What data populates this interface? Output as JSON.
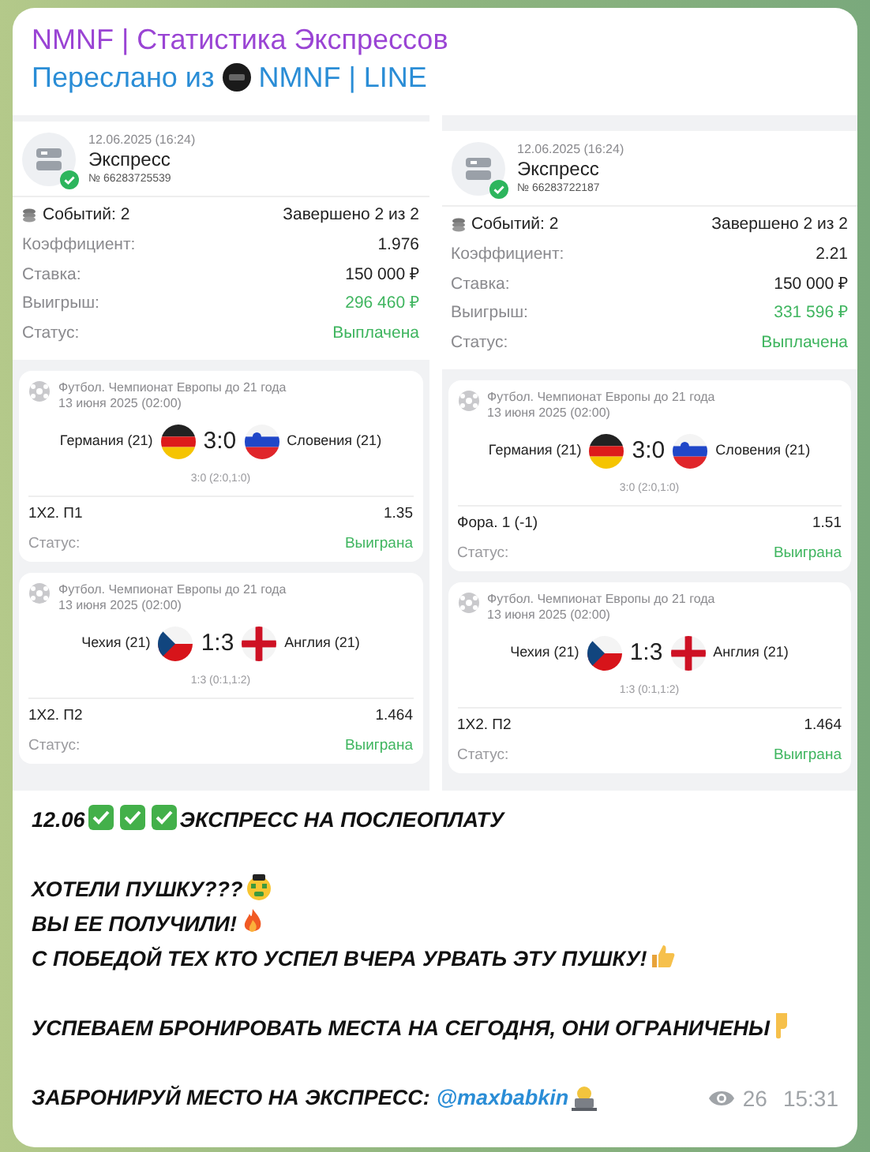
{
  "title": "NMNF | Статистика Экспрессов",
  "forwarded": {
    "label": "Переслано из",
    "channel": "NMNF | LINE"
  },
  "slips": [
    {
      "date": "12.06.2025 (16:24)",
      "title": "Экспресс",
      "number": "№ 66283725539",
      "events": "Событий: 2",
      "completed": "Завершено 2 из 2",
      "rows": [
        {
          "label": "Коэффициент:",
          "value": "1.976"
        },
        {
          "label": "Ставка:",
          "value": "150 000 ₽"
        },
        {
          "label": "Выигрыш:",
          "value": "296 460 ₽"
        },
        {
          "label": "Статус:",
          "value": "Выплачена"
        }
      ],
      "matches": [
        {
          "league": "Футбол. Чемпионат Европы до 21 года",
          "date": "13 июня 2025 (02:00)",
          "home": "Германия (21)",
          "score": "3:0",
          "away": "Словения (21)",
          "detail": "3:0 (2:0,1:0)",
          "market": "1X2. П1",
          "odds": "1.35",
          "status_label": "Статус:",
          "status": "Выиграна"
        },
        {
          "league": "Футбол. Чемпионат Европы до 21 года",
          "date": "13 июня 2025 (02:00)",
          "home": "Чехия (21)",
          "score": "1:3",
          "away": "Англия (21)",
          "detail": "1:3 (0:1,1:2)",
          "market": "1X2. П2",
          "odds": "1.464",
          "status_label": "Статус:",
          "status": "Выиграна"
        }
      ]
    },
    {
      "date": "12.06.2025 (16:24)",
      "title": "Экспресс",
      "number": "№ 66283722187",
      "events": "Событий: 2",
      "completed": "Завершено 2 из 2",
      "rows": [
        {
          "label": "Коэффициент:",
          "value": "2.21"
        },
        {
          "label": "Ставка:",
          "value": "150 000 ₽"
        },
        {
          "label": "Выигрыш:",
          "value": "331 596 ₽"
        },
        {
          "label": "Статус:",
          "value": "Выплачена"
        }
      ],
      "matches": [
        {
          "league": "Футбол. Чемпионат Европы до 21 года",
          "date": "13 июня 2025 (02:00)",
          "home": "Германия (21)",
          "score": "3:0",
          "away": "Словения (21)",
          "detail": "3:0 (2:0,1:0)",
          "market": "Фора. 1 (-1)",
          "odds": "1.51",
          "status_label": "Статус:",
          "status": "Выиграна"
        },
        {
          "league": "Футбол. Чемпионат Европы до 21 года",
          "date": "13 июня 2025 (02:00)",
          "home": "Чехия (21)",
          "score": "1:3",
          "away": "Англия (21)",
          "detail": "1:3 (0:1,1:2)",
          "market": "1X2. П2",
          "odds": "1.464",
          "status_label": "Статус:",
          "status": "Выиграна"
        }
      ]
    }
  ],
  "message": [
    {
      "lines": [
        {
          "segments": [
            {
              "kind": "text",
              "text": "12.06"
            },
            {
              "kind": "check"
            },
            {
              "kind": "check"
            },
            {
              "kind": "check"
            },
            {
              "kind": "text",
              "text": "ЭКСПРЕСС НА ПОСЛЕОПЛАТУ"
            }
          ]
        }
      ]
    },
    {
      "lines": [
        {
          "segments": [
            {
              "kind": "text",
              "text": "ХОТЕЛИ ПУШКУ???"
            },
            {
              "kind": "money"
            }
          ]
        },
        {
          "segments": [
            {
              "kind": "text",
              "text": "ВЫ ЕЕ ПОЛУЧИЛИ!"
            },
            {
              "kind": "fire"
            }
          ]
        },
        {
          "segments": [
            {
              "kind": "text",
              "text": "С ПОБЕДОЙ ТЕХ КТО УСПЕЛ ВЧЕРА УРВАТЬ ЭТУ ПУШКУ!"
            },
            {
              "kind": "thumb"
            }
          ]
        }
      ]
    },
    {
      "lines": [
        {
          "segments": [
            {
              "kind": "text",
              "text": "УСПЕВАЕМ БРОНИРОВАТЬ МЕСТА НА СЕГОДНЯ, ОНИ ОГРАНИЧЕНЫ"
            },
            {
              "kind": "point"
            }
          ]
        }
      ]
    },
    {
      "lines": [
        {
          "segments": [
            {
              "kind": "text",
              "text": "ЗАБРОНИРУЙ МЕСТО НА ЭКСПРЕСС:"
            },
            {
              "kind": "link",
              "text": "@maxbabkin"
            },
            {
              "kind": "laptop"
            }
          ]
        }
      ]
    }
  ],
  "views": "26",
  "time": "15:31"
}
